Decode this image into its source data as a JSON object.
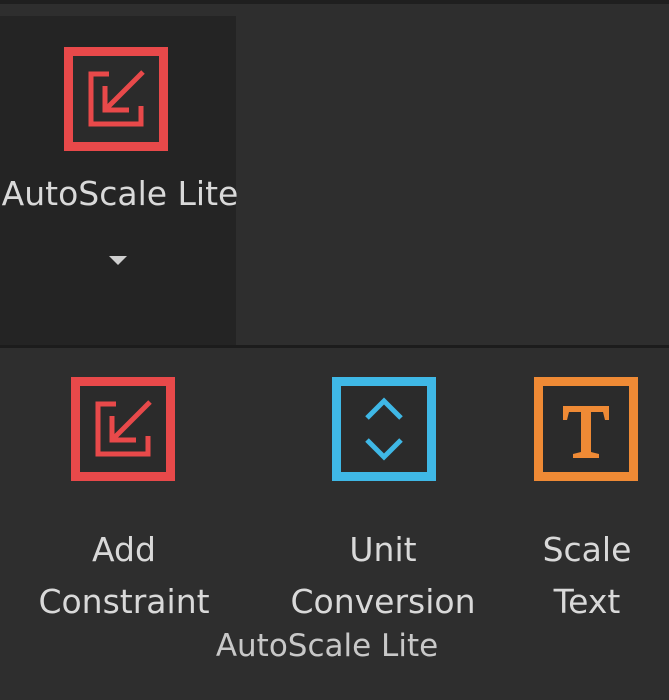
{
  "plugin": {
    "button_label": "AutoScale Lite",
    "icon": "scale-arrow-icon",
    "has_dropdown": true
  },
  "tools": [
    {
      "label_line1": "Add",
      "label_line2": "Constraint",
      "icon": "scale-arrow-icon",
      "color": "#e8494a"
    },
    {
      "label_line1": "Unit",
      "label_line2": "Conversion",
      "icon": "chevrons-up-down-icon",
      "color": "#3fb8e6"
    },
    {
      "label_line1": "Scale",
      "label_line2": "Text",
      "icon": "letter-t-icon",
      "color": "#ef8a35"
    }
  ],
  "group": {
    "label": "AutoScale Lite"
  },
  "colors": {
    "background": "#2e2e2e",
    "button_bg": "#242424",
    "text": "#d9d9d9",
    "red": "#e8494a",
    "blue": "#3fb8e6",
    "orange": "#ef8a35"
  }
}
